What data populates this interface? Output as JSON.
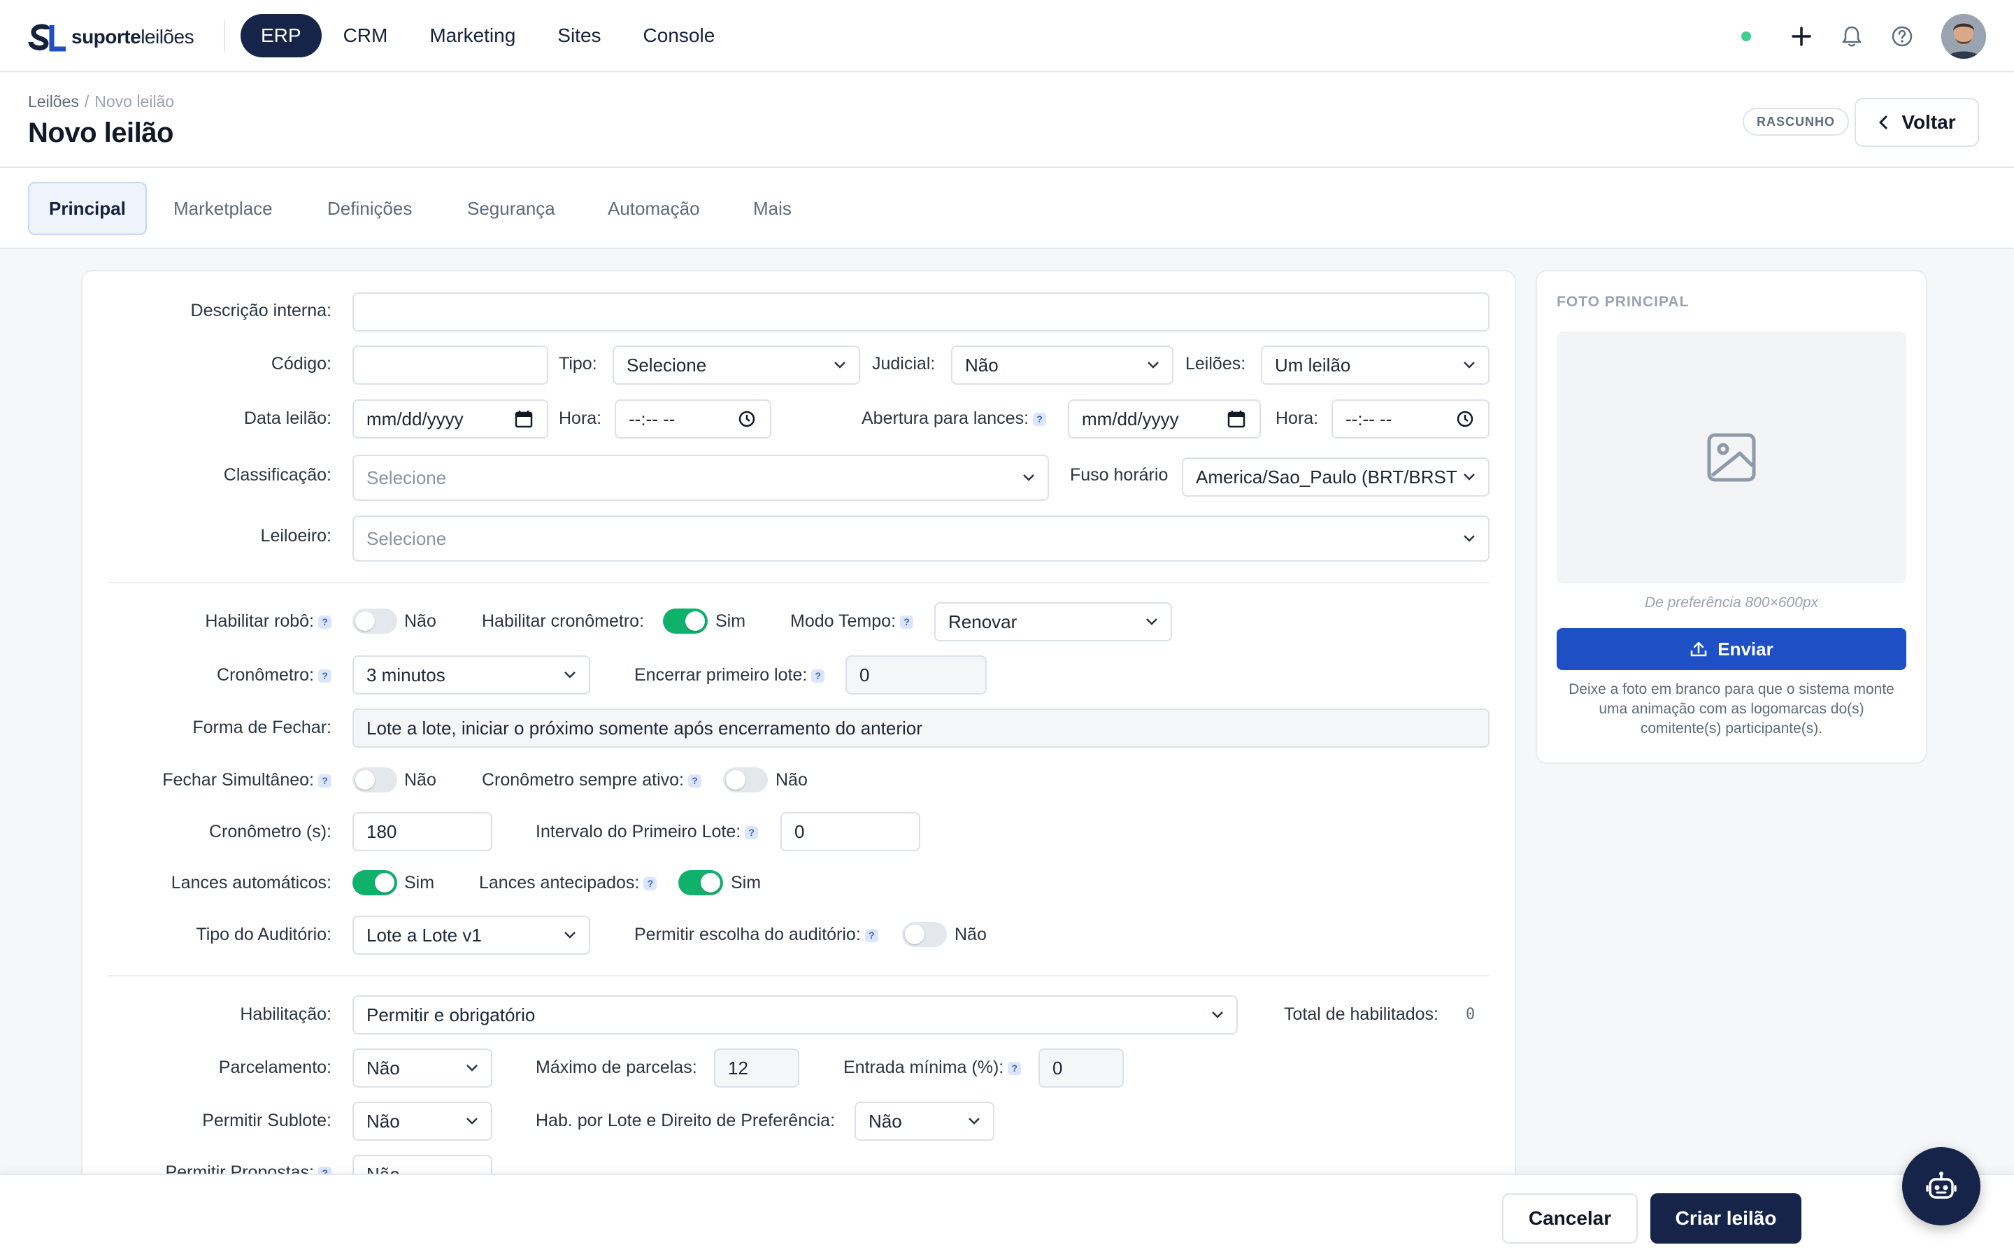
{
  "brand": {
    "logo_mark": "SL",
    "logo_bold": "suporte",
    "logo_light": "leilões"
  },
  "nav": {
    "items": [
      {
        "label": "ERP"
      },
      {
        "label": "CRM"
      },
      {
        "label": "Marketing"
      },
      {
        "label": "Sites"
      },
      {
        "label": "Console"
      }
    ],
    "active": "ERP"
  },
  "topbar": {
    "icons": [
      "status-dot",
      "plus-icon",
      "bell-icon",
      "help-icon",
      "avatar"
    ]
  },
  "header": {
    "breadcrumb": {
      "parent": "Leilões",
      "separator": "/",
      "current": "Novo leilão"
    },
    "title": "Novo leilão",
    "badge": "RASCUNHO",
    "back_label": "Voltar"
  },
  "tabs": [
    "Principal",
    "Marketplace",
    "Definições",
    "Segurança",
    "Automação",
    "Mais"
  ],
  "form": {
    "descricao_label": "Descrição interna:",
    "descricao_value": "",
    "codigo_label": "Código:",
    "codigo_value": "",
    "tipo_label": "Tipo:",
    "tipo_value": "Selecione",
    "judicial_label": "Judicial:",
    "judicial_value": "Não",
    "leiloes_label": "Leilões:",
    "leiloes_value": "Um leilão",
    "data_label": "Data leilão:",
    "data_value": "mm/dd/yyyy",
    "hora_label": "Hora:",
    "hora_value": "--:-- --",
    "abertura_label": "Abertura para lances:",
    "abertura_value": "mm/dd/yyyy",
    "hora2_label": "Hora:",
    "hora2_value": "--:-- --",
    "classificacao_label": "Classificação:",
    "classificacao_value": "Selecione",
    "fuso_label": "Fuso horário",
    "fuso_value": "America/Sao_Paulo (BRT/BRST",
    "leiloeiro_label": "Leiloeiro:",
    "leiloeiro_value": "Selecione",
    "robo_label": "Habilitar robô:",
    "robo_value": "Não",
    "cronometro_hab_label": "Habilitar cronômetro:",
    "cronometro_hab_value": "Sim",
    "modo_tempo_label": "Modo Tempo:",
    "modo_tempo_value": "Renovar",
    "cronometro_label": "Cronômetro:",
    "cronometro_value": "3 minutos",
    "encerrar_label": "Encerrar primeiro lote:",
    "encerrar_value": "0",
    "forma_label": "Forma de Fechar:",
    "forma_value": "Lote a lote, iniciar o próximo somente após encerramento do anterior",
    "fechar_sim_label": "Fechar Simultâneo:",
    "fechar_sim_value": "Não",
    "crono_ativo_label": "Cronômetro sempre ativo:",
    "crono_ativo_value": "Não",
    "crono_s_label": "Cronômetro (s):",
    "crono_s_value": "180",
    "intervalo_label": "Intervalo do Primeiro Lote:",
    "intervalo_value": "0",
    "lances_auto_label": "Lances automáticos:",
    "lances_auto_value": "Sim",
    "lances_ant_label": "Lances antecipados:",
    "lances_ant_value": "Sim",
    "auditorio_label": "Tipo do Auditório:",
    "auditorio_value": "Lote a Lote v1",
    "permitir_aud_label": "Permitir escolha do auditório:",
    "permitir_aud_value": "Não",
    "habilitacao_label": "Habilitação:",
    "habilitacao_value": "Permitir e obrigatório",
    "total_hab_label": "Total de habilitados:",
    "total_hab_value": "0",
    "parcelamento_label": "Parcelamento:",
    "parcelamento_value": "Não",
    "max_parcelas_label": "Máximo de parcelas:",
    "max_parcelas_value": "12",
    "entrada_label": "Entrada mínima (%):",
    "entrada_value": "0",
    "sublote_label": "Permitir Sublote:",
    "sublote_value": "Não",
    "hab_lote_label": "Hab. por Lote e Direito de Preferência:",
    "hab_lote_value": "Não",
    "propostas_label": "Permitir Propostas:",
    "propostas_value": "Não",
    "help_mark": "?"
  },
  "side": {
    "title": "FOTO PRINCIPAL",
    "hint": "De preferência 800×600px",
    "send_label": "Enviar",
    "note": "Deixe a foto em branco para que o sistema monte uma animação com as logomarcas do(s) comitente(s) participante(s)."
  },
  "footer": {
    "cancel_label": "Cancelar",
    "create_label": "Criar leilão"
  },
  "colors": {
    "primary": "#172449",
    "accent_blue": "#1f4fc5",
    "toggle_on": "#10b26b"
  }
}
